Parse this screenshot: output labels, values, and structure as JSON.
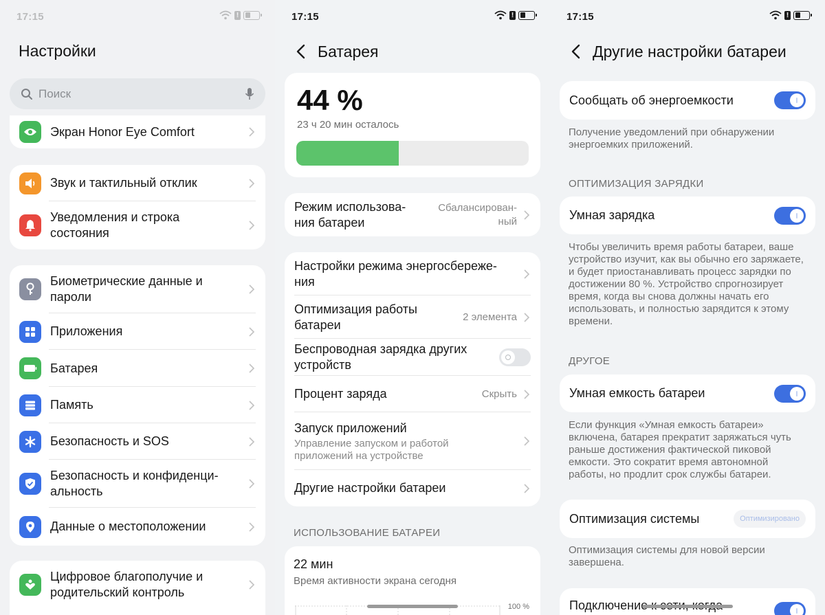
{
  "status": {
    "time": "17:15"
  },
  "screen1": {
    "title": "Настройки",
    "search_placeholder": "Поиск",
    "partial_item": "Экран Honor Eye Comfort",
    "group_sound": [
      "Звук и тактильный отклик",
      "Уведомления и строка состояния"
    ],
    "group_main": [
      "Биометрические данные и пароли",
      "Приложения",
      "Батарея",
      "Память",
      "Безопасность и SOS",
      "Безопасность и конфиденци­альность",
      "Данные о местоположении"
    ],
    "bottom_item": "Цифровое благополучие и родительский контроль"
  },
  "screen2": {
    "title": "Батарея",
    "percent": "44 %",
    "remaining": "23 ч 20 мин осталось",
    "level_fraction": 0.44,
    "mode_label": "Режим использова­ния батареи",
    "mode_value": "Сбалансирован­ный",
    "power_saving": "Настройки режима энергосбереже­ния",
    "optimization_label": "Оптимизация работы батареи",
    "optimization_value": "2 элемента",
    "wireless_label": "Беспроводная зарядка других устройств",
    "percent_label": "Процент заряда",
    "percent_value": "Скрыть",
    "launch_label": "Запуск приложений",
    "launch_sub": "Управление запуском и работой приложений на устройстве",
    "other_label": "Другие настройки батареи",
    "usage_header": "ИСПОЛЬЗОВАНИЕ БАТАРЕИ",
    "usage_time": "22 мин",
    "usage_desc": "Время активности экрана сегодня",
    "chart_max_label": "100 %"
  },
  "screen3": {
    "title": "Другие настройки батареи",
    "report_label": "Сообщать об энергоемкости",
    "report_desc": "Получение уведомлений при обнаружении энергоемких приложений.",
    "charging_header": "ОПТИМИЗАЦИЯ ЗАРЯДКИ",
    "smart_charge_label": "Умная зарядка",
    "smart_charge_desc": "Чтобы увеличить время работы батареи, ваше устройство изучит, как вы обычно его заряжаете, и будет приостанавливать процесс зарядки по достижении 80 %. Устройство спрогнозирует время, когда вы снова должны начать его использовать, и полностью зарядится к этому времени.",
    "other_header": "ДРУГОЕ",
    "smart_capacity_label": "Умная емкость батареи",
    "smart_capacity_desc": "Если функция «Умная емкость батареи» включена, батарея прекратит заряжаться чуть раньше достижения фактической пико­вой емкости. Это сократит время автономной работы, но продлит срок службы батареи.",
    "system_opt_label": "Оптимизация системы",
    "system_opt_badge": "Оптимизировано",
    "system_opt_desc": "Оптимизация системы для новой версии завершена.",
    "network_label": "Подключение к сети, когда"
  }
}
